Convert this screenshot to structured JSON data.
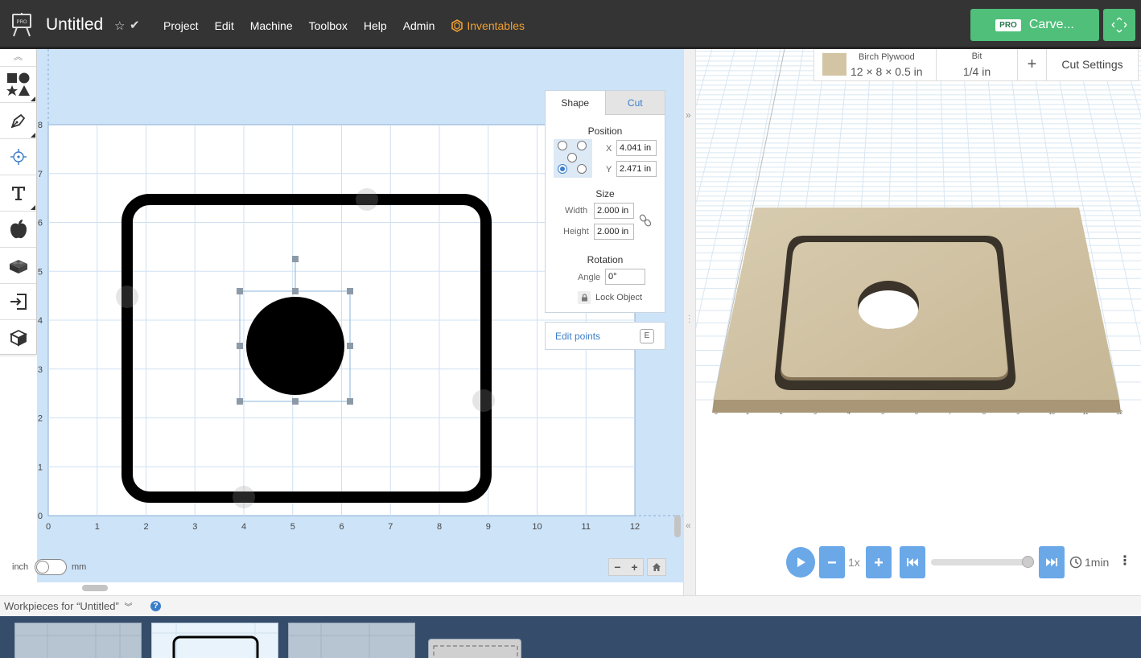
{
  "header": {
    "logo_badge": "PRO",
    "title": "Untitled",
    "menu": [
      "Project",
      "Edit",
      "Machine",
      "Toolbox",
      "Help",
      "Admin"
    ],
    "inventables": "Inventables",
    "carve_badge": "PRO",
    "carve_label": "Carve..."
  },
  "toolbar": {
    "tools": [
      "shapes-icon",
      "pen-icon",
      "point-icon",
      "text-icon",
      "apple-icon",
      "lego-icon",
      "import-icon",
      "box-icon"
    ]
  },
  "design": {
    "y_ticks": [
      "0",
      "1",
      "2",
      "3",
      "4",
      "5",
      "6",
      "7",
      "8"
    ],
    "x_ticks": [
      "0",
      "1",
      "2",
      "3",
      "4",
      "5",
      "6",
      "7",
      "8",
      "9",
      "10",
      "11",
      "12"
    ],
    "unit_left": "inch",
    "unit_right": "mm",
    "zoom_out": "−",
    "zoom_in": "+"
  },
  "shape_panel": {
    "tab_shape": "Shape",
    "tab_cut": "Cut",
    "position_label": "Position",
    "x_label": "X",
    "x_value": "4.041 in",
    "y_label": "Y",
    "y_value": "2.471 in",
    "size_label": "Size",
    "width_label": "Width",
    "width_value": "2.000 in",
    "height_label": "Height",
    "height_value": "2.000 in",
    "rotation_label": "Rotation",
    "angle_label": "Angle",
    "angle_value": "0°",
    "lock_label": "Lock Object",
    "edit_points": "Edit points",
    "edit_key": "E"
  },
  "preview": {
    "material_name": "Birch Plywood",
    "material_dims": "12 × 8 × 0.5 in",
    "bit_label": "Bit",
    "bit_value": "1/4 in",
    "add_label": "+",
    "cut_settings": "Cut Settings",
    "x_ticks": [
      "0",
      "1",
      "2",
      "3",
      "4",
      "5",
      "6",
      "7",
      "8",
      "9",
      "10",
      "11",
      "12"
    ],
    "speed": "1x",
    "time": "1min",
    "material_color": "#d3c4a4"
  },
  "workpieces": {
    "title": "Workpieces for “Untitled”",
    "help": "?"
  },
  "colors": {
    "accent_green": "#4fbf7a",
    "accent_blue": "#6aa8e8",
    "link_blue": "#3a7dc9",
    "inventables_orange": "#f0a030"
  }
}
